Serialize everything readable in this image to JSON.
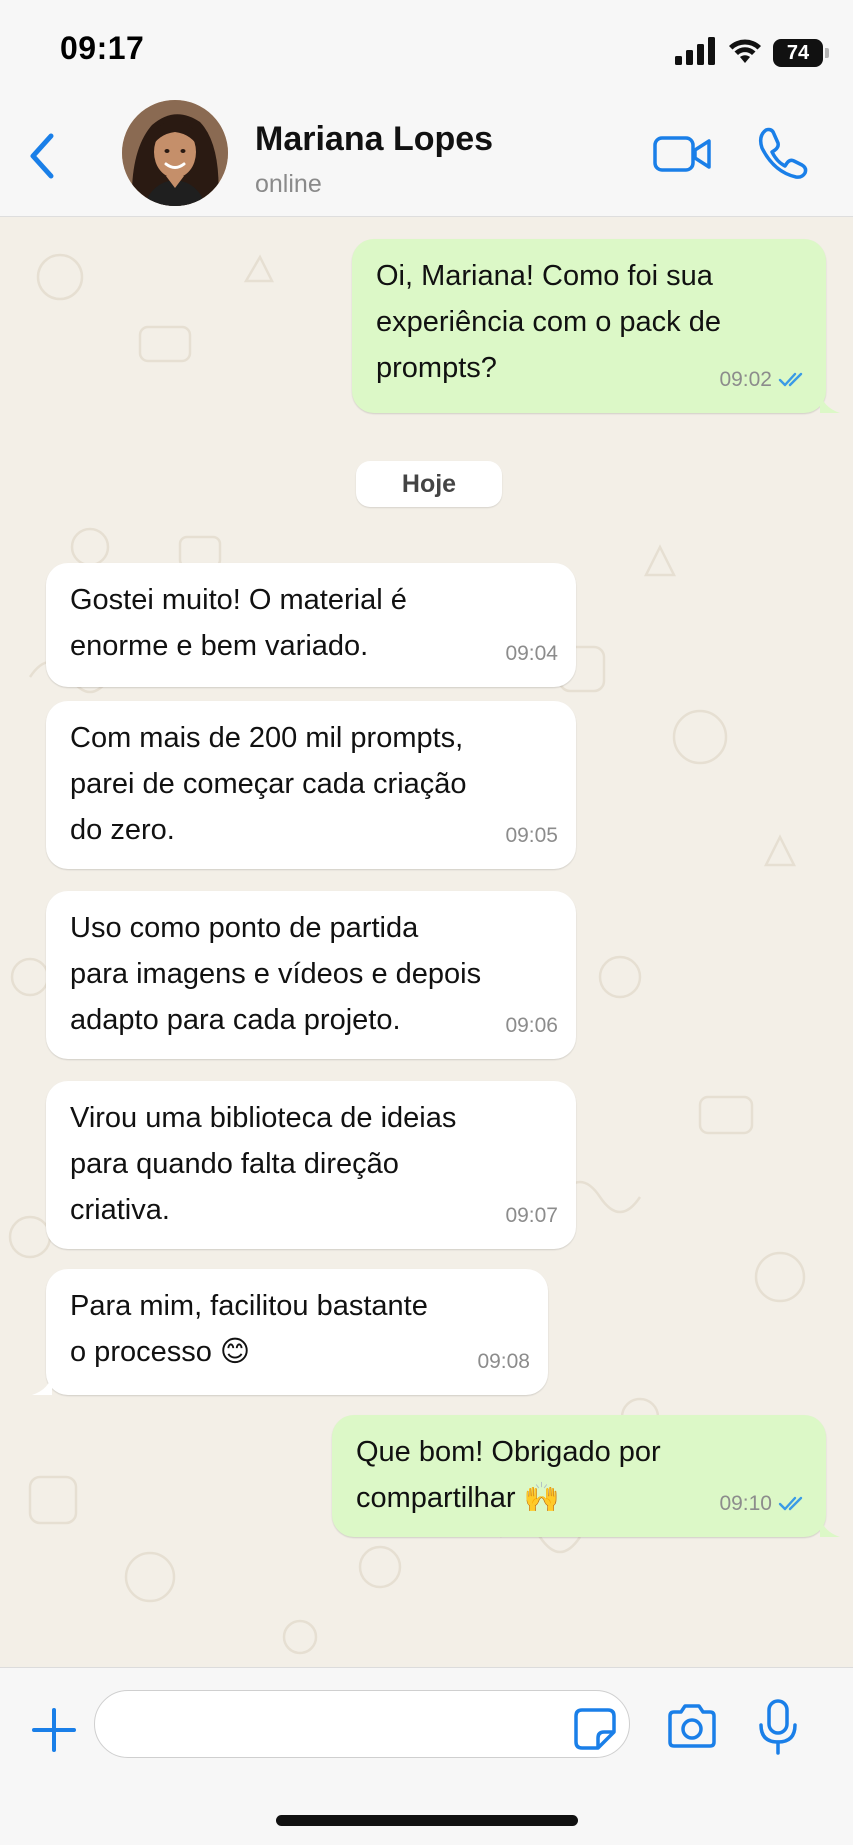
{
  "status_bar": {
    "time": "09:17",
    "battery": "74"
  },
  "header": {
    "contact_name": "Mariana Lopes",
    "contact_status": "online",
    "icons": [
      "back-chevron-icon",
      "video-call-icon",
      "phone-call-icon"
    ]
  },
  "chat": {
    "date_separator": "Hoje",
    "messages": [
      {
        "direction": "outgoing",
        "text": "Oi, Mariana! Como foi sua\nexperiência com o pack de\nprompts?",
        "time": "09:02",
        "read": true
      },
      {
        "direction": "incoming",
        "text": "Gostei muito! O material é\nenorme e bem variado.",
        "time": "09:04"
      },
      {
        "direction": "incoming",
        "text": "Com mais de 200 mil prompts,\nparei de começar cada criação\ndo zero.",
        "time": "09:05"
      },
      {
        "direction": "incoming",
        "text": "Uso como ponto de partida\npara imagens e vídeos e depois\nadapto para cada projeto.",
        "time": "09:06"
      },
      {
        "direction": "incoming",
        "text": "Virou uma biblioteca de ideias\npara quando falta direção\ncriativa.",
        "time": "09:07"
      },
      {
        "direction": "incoming",
        "text": "Para mim, facilitou bastante\no processo 😊",
        "time": "09:08"
      },
      {
        "direction": "outgoing",
        "text": "Que bom! Obrigado por\ncompartilhar 🙌",
        "time": "09:10",
        "read": true
      }
    ]
  },
  "input_bar": {
    "placeholder": "",
    "icons": [
      "plus-icon",
      "sticker-icon",
      "camera-icon",
      "microphone-icon"
    ]
  },
  "colors": {
    "accent": "#1a7fe8",
    "outgoing_bubble": "#dcf8c7",
    "incoming_bubble": "#ffffff",
    "wallpaper": "#f3efe7",
    "read_ticks": "#3a9be6"
  }
}
